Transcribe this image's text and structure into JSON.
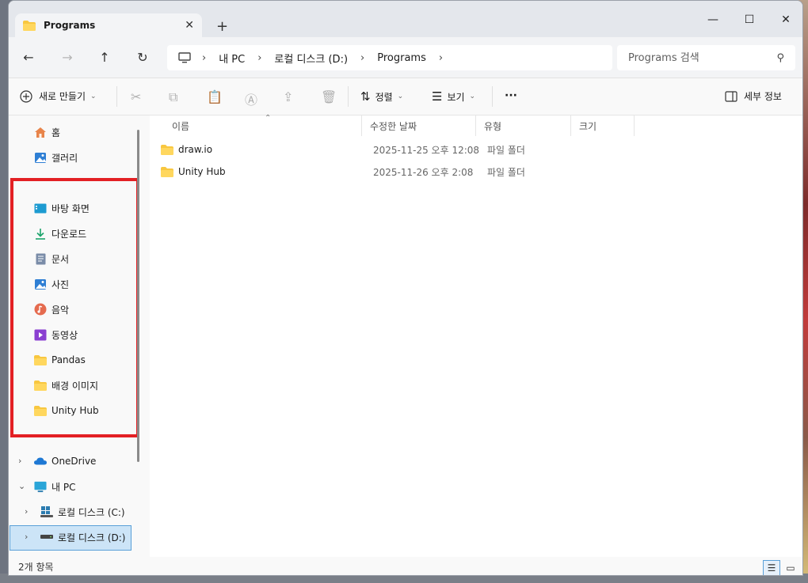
{
  "window": {
    "tab_title": "Programs",
    "tab_close": "✕",
    "new_tab": "+",
    "minimize": "—",
    "maximize": "☐",
    "close": "✕"
  },
  "nav": {
    "back": "←",
    "forward": "→",
    "up": "↑",
    "refresh": "↻",
    "breadcrumbs": [
      "내 PC",
      "로컬 디스크 (D:)",
      "Programs"
    ],
    "crumb_sep": "›",
    "search_placeholder": "Programs 검색",
    "search_icon": "⚲"
  },
  "toolbar": {
    "new_label": "새로 만들기",
    "sort_label": "정렬",
    "view_label": "보기",
    "more_label": "···",
    "details_label": "세부 정보"
  },
  "sidebar": {
    "home": "홈",
    "gallery": "갤러리",
    "pinned": [
      {
        "label": "바탕 화면",
        "icon": "desktop-icon"
      },
      {
        "label": "다운로드",
        "icon": "download-icon"
      },
      {
        "label": "문서",
        "icon": "document-icon"
      },
      {
        "label": "사진",
        "icon": "pictures-icon"
      },
      {
        "label": "음악",
        "icon": "music-icon"
      },
      {
        "label": "동영상",
        "icon": "video-icon"
      },
      {
        "label": "Pandas",
        "icon": "folder-icon"
      },
      {
        "label": "배경 이미지",
        "icon": "folder-icon"
      },
      {
        "label": "Unity Hub",
        "icon": "folder-icon"
      }
    ],
    "onedrive": "OneDrive",
    "this_pc": "내 PC",
    "drive_c": "로컬 디스크 (C:)",
    "drive_d": "로컬 디스크 (D:)"
  },
  "columns": {
    "name": "이름",
    "date": "수정한 날짜",
    "type": "유형",
    "size": "크기"
  },
  "files": [
    {
      "name": "draw.io",
      "date": "2025-11-25 오후 12:08",
      "type": "파일 폴더"
    },
    {
      "name": "Unity Hub",
      "date": "2025-11-26 오후 2:08",
      "type": "파일 폴더"
    }
  ],
  "status": {
    "count": "2개 항목"
  },
  "colors": {
    "highlight": "#e32024",
    "folder": "#f8c740",
    "selection": "#cce4f7"
  }
}
